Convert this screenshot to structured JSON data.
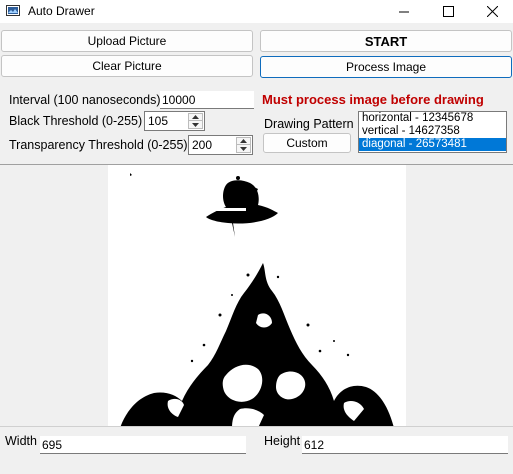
{
  "window": {
    "title": "Auto Drawer"
  },
  "buttons": {
    "upload": "Upload Picture",
    "start": "START",
    "clear": "Clear Picture",
    "process": "Process Image",
    "custom": "Custom"
  },
  "settings": {
    "interval_label": "Interval (100 nanoseconds)",
    "interval_value": "10000",
    "black_label": "Black Threshold (0-255)",
    "black_value": "105",
    "transparency_label": "Transparency Threshold (0-255)",
    "transparency_value": "200"
  },
  "status": {
    "warning": "Must process image before drawing"
  },
  "drawing_pattern": {
    "label": "Drawing Pattern",
    "options": [
      "horizontal - 12345678",
      "vertical - 14627358",
      "diagonal - 26573481"
    ],
    "selected": "diagonal - 26573481"
  },
  "size": {
    "width_label": "Width",
    "width_value": "695",
    "height_label": "Height",
    "height_value": "612"
  },
  "colors": {
    "accent": "#0078d7",
    "warning": "#c00000",
    "window_bg": "#f0f0f0"
  }
}
